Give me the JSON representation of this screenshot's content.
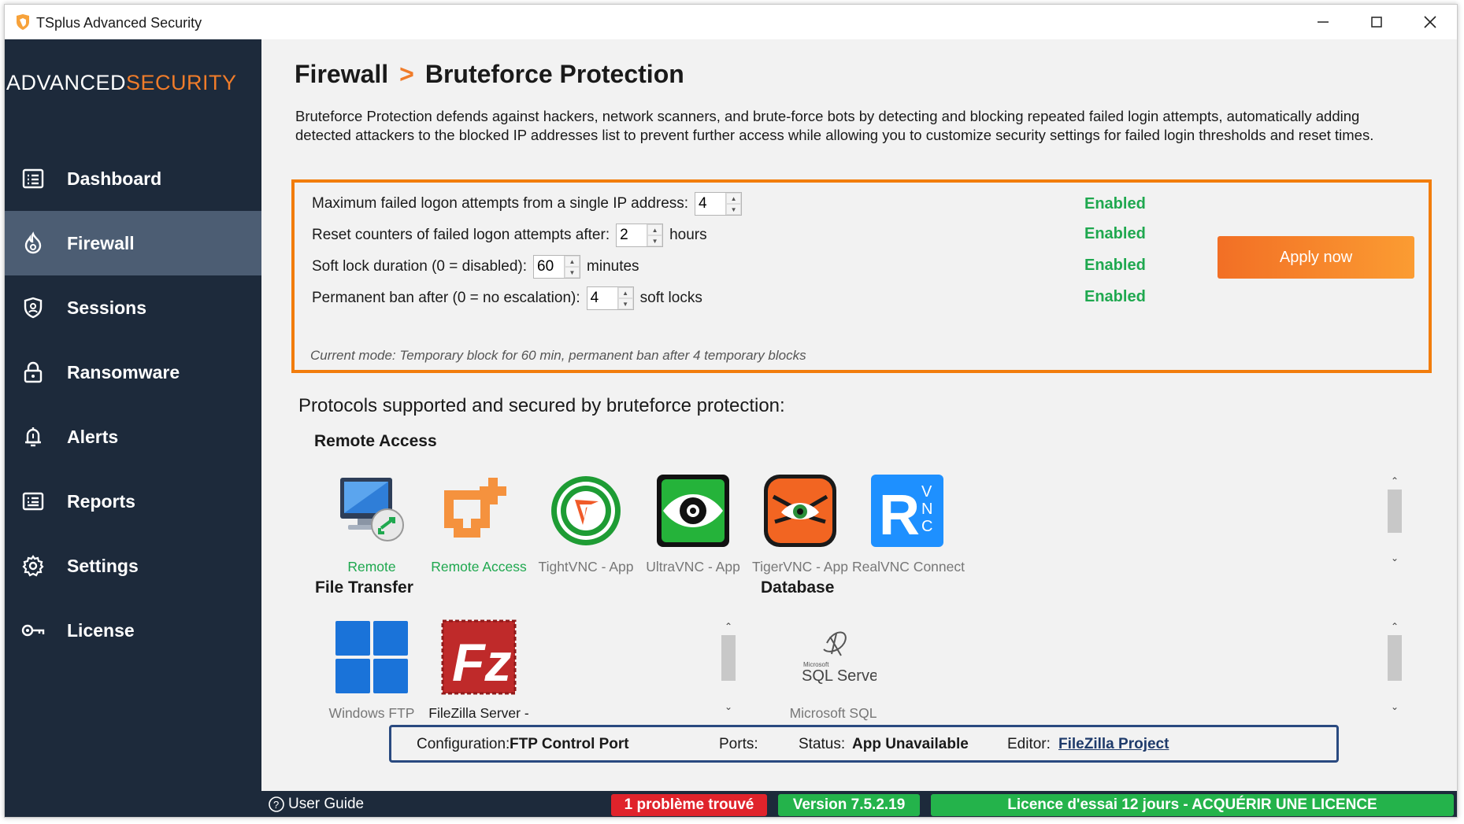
{
  "window": {
    "title": "TSplus Advanced Security",
    "minimize": "–",
    "maximize": "☐",
    "close": "✕"
  },
  "brand": {
    "part1": "ADVANCED",
    "part2": "SECURITY",
    "color1": "#ffffff",
    "color2": "#f07c2a"
  },
  "sidebar": {
    "items": [
      {
        "label": "Dashboard",
        "icon": "dashboard-icon"
      },
      {
        "label": "Firewall",
        "icon": "firewall-icon",
        "active": true
      },
      {
        "label": "Sessions",
        "icon": "sessions-icon"
      },
      {
        "label": "Ransomware",
        "icon": "lock-icon"
      },
      {
        "label": "Alerts",
        "icon": "bell-icon"
      },
      {
        "label": "Reports",
        "icon": "report-icon"
      },
      {
        "label": "Settings",
        "icon": "gear-icon"
      },
      {
        "label": "License",
        "icon": "key-icon"
      }
    ]
  },
  "breadcrumb": {
    "parent": "Firewall",
    "separator": ">",
    "current": "Bruteforce Protection"
  },
  "description": "Bruteforce Protection defends against hackers, network scanners, and brute-force bots by detecting and blocking repeated failed login attempts, automatically adding detected attackers to the blocked IP addresses list to prevent further access while allowing you to customize security settings for failed login thresholds and reset times.",
  "settings": {
    "max_attempts": {
      "label": "Maximum failed logon attempts from a single IP address:",
      "value": "4",
      "unit": "",
      "status": "Enabled"
    },
    "reset_counters": {
      "label": "Reset counters of failed logon attempts after:",
      "value": "2",
      "unit": "hours",
      "status": "Enabled"
    },
    "soft_lock": {
      "label": "Soft lock duration (0 = disabled):",
      "value": "60",
      "unit": "minutes",
      "status": "Enabled"
    },
    "permanent_ban": {
      "label": "Permanent ban after (0 = no escalation):",
      "value": "4",
      "unit": "soft locks",
      "status": "Enabled"
    },
    "apply_label": "Apply now",
    "current_mode": "Current mode: Temporary block for 60 min, permanent ban after 4 temporary blocks"
  },
  "protocols": {
    "title": "Protocols supported and secured by bruteforce protection:",
    "remote_access": {
      "title": "Remote Access",
      "apps": [
        {
          "name": "Remote",
          "icon": "remote-desktop-icon",
          "color": "#1fa84f"
        },
        {
          "name": "Remote Access",
          "icon": "remote-access-icon",
          "color": "#1fa84f"
        },
        {
          "name": "TightVNC - App",
          "icon": "tightvnc-icon",
          "color": "#777777"
        },
        {
          "name": "UltraVNC - App",
          "icon": "ultravnc-icon",
          "color": "#777777"
        },
        {
          "name": "TigerVNC - App",
          "icon": "tigervnc-icon",
          "color": "#777777"
        },
        {
          "name": "RealVNC Connect",
          "icon": "realvnc-icon",
          "color": "#777777"
        }
      ]
    },
    "file_transfer": {
      "title": "File Transfer",
      "apps": [
        {
          "name": "Windows FTP",
          "icon": "windows-icon",
          "color": "#777777"
        },
        {
          "name": "FileZilla Server -",
          "icon": "filezilla-icon",
          "color": "#1a1a1a"
        }
      ]
    },
    "database": {
      "title": "Database",
      "apps": [
        {
          "name": "Microsoft SQL",
          "icon": "sql-server-icon",
          "color": "#777777",
          "logo_text": "SQL Server",
          "logo_small": "Microsoft"
        }
      ]
    }
  },
  "config_bar": {
    "config_label": "Configuration:",
    "config_value": "FTP Control Port",
    "ports_label": "Ports:",
    "status_label": "Status:",
    "status_value": "App Unavailable",
    "editor_label": "Editor:",
    "editor_value": "FileZilla Project"
  },
  "statusbar": {
    "user_guide": "User Guide",
    "problem": "1 problème trouvé",
    "version": "Version 7.5.2.19",
    "license": "Licence d'essai 12 jours - ACQUÉRIR UNE LICENCE",
    "colors": {
      "problem": "#e0232b",
      "version": "#24b34b",
      "license": "#24b34b"
    }
  }
}
